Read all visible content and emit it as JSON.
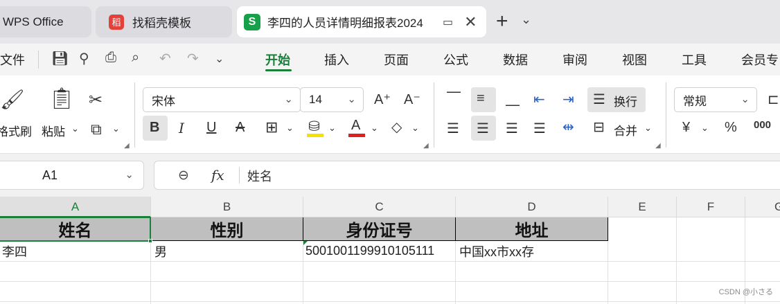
{
  "tabs": {
    "wps": "WPS Office",
    "template": "找稻壳模板",
    "document": "李四的人员详情明细报表2024",
    "template_icon": "稻",
    "doc_icon": "S",
    "new_tab": "+"
  },
  "menu": {
    "file": "文件",
    "tabs": [
      "开始",
      "插入",
      "页面",
      "公式",
      "数据",
      "审阅",
      "视图",
      "工具",
      "会员专"
    ],
    "active_tab": "开始"
  },
  "ribbon": {
    "format_painter": "格式刷",
    "paste": "粘贴",
    "font_name": "宋体",
    "font_size": "14",
    "wrap": "换行",
    "merge": "合并",
    "number_format": "常规",
    "currency": "¥",
    "percent": "%",
    "thousands": "000"
  },
  "formula_bar": {
    "name_box": "A1",
    "fx": "fx",
    "content": "姓名"
  },
  "sheet": {
    "columns": [
      "A",
      "B",
      "C",
      "D",
      "E",
      "F",
      "G"
    ],
    "header_row": [
      "姓名",
      "性别",
      "身份证号",
      "地址"
    ],
    "data_row": [
      "李四",
      "男",
      "500100119991010511​1",
      "中国xx市xx存"
    ]
  },
  "watermark": "CSDN @小さる",
  "colors": {
    "accent": "#1a7f3a",
    "font_color_underline": "#e02020",
    "fill_color_underline": "#f5e000"
  }
}
